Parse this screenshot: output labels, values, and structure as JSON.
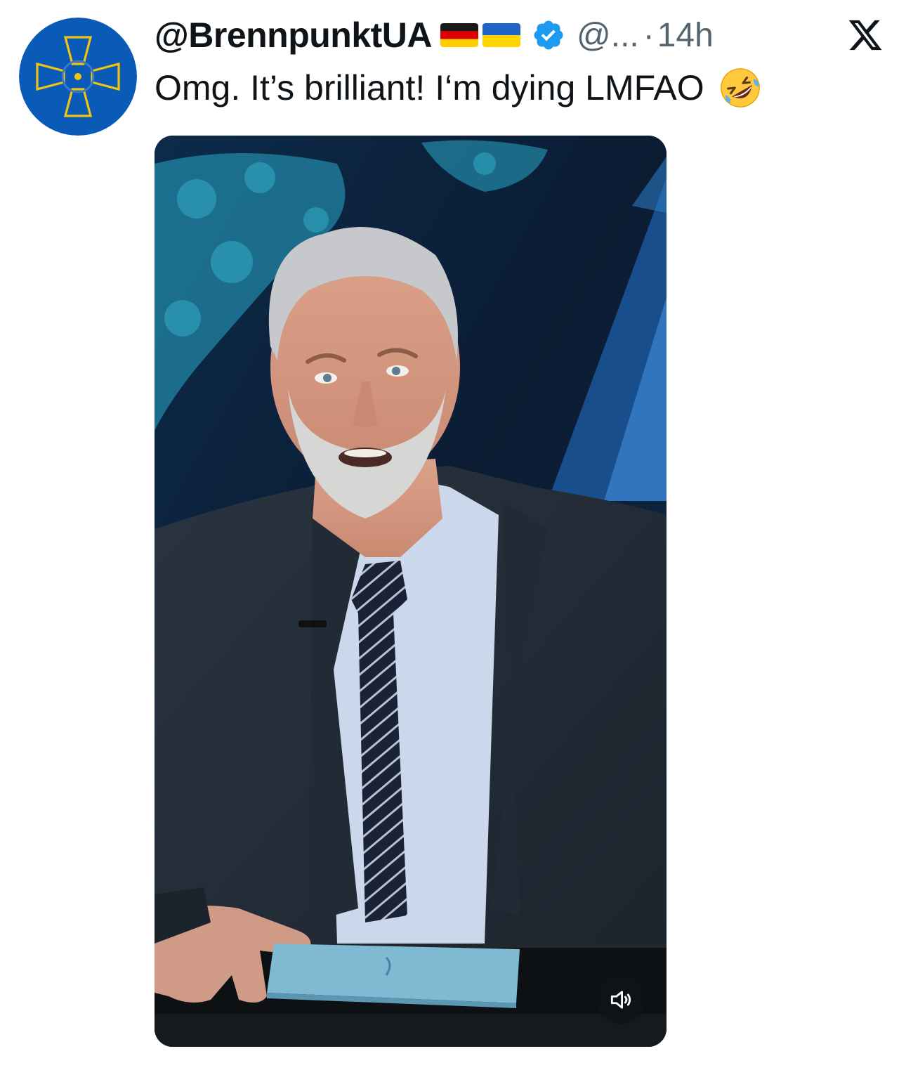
{
  "tweet": {
    "display_name": "@BrennpunktUA",
    "flags": [
      "germany-flag-icon",
      "ukraine-flag-icon"
    ],
    "verified_icon": "verified-badge-icon",
    "handle": "@...",
    "separator": "·",
    "timestamp": "14h",
    "text": "Omg. It’s brilliant! I‘m dying LMFAO",
    "emoji": "rolling-on-floor-laughing-emoji"
  },
  "brand": {
    "logo": "x-logo-icon"
  },
  "media": {
    "type": "video",
    "mute_control": "speaker-icon"
  },
  "colors": {
    "text_primary": "#0f1419",
    "text_secondary": "#536471",
    "verified_blue": "#1d9bf0",
    "avatar_blue": "#0057b7",
    "avatar_yellow": "#ffd500"
  }
}
